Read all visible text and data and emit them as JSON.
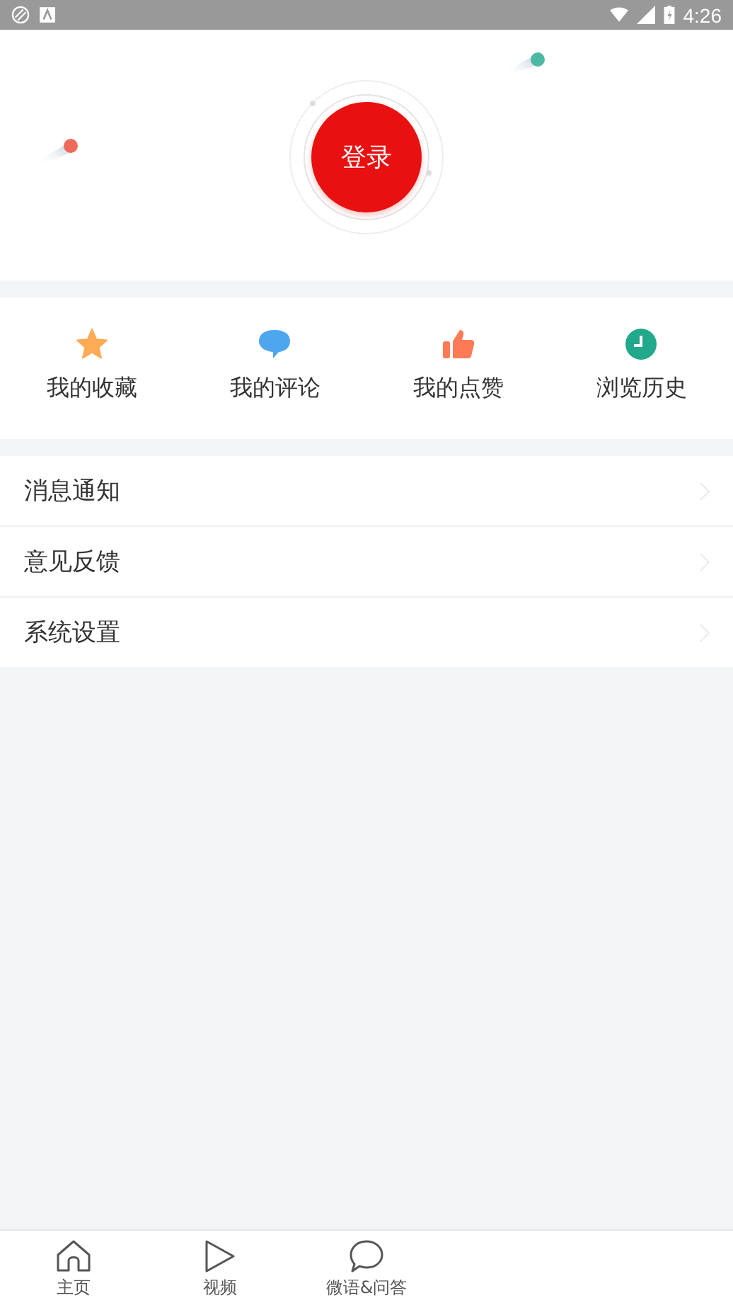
{
  "status_bar": {
    "time": "4:26"
  },
  "login": {
    "label": "登录"
  },
  "shortcuts": [
    {
      "kind": "star",
      "label": "我的收藏"
    },
    {
      "kind": "comment",
      "label": "我的评论"
    },
    {
      "kind": "like",
      "label": "我的点赞"
    },
    {
      "kind": "clock",
      "label": "浏览历史"
    }
  ],
  "menu": [
    {
      "label": "消息通知"
    },
    {
      "label": "意见反馈"
    },
    {
      "label": "系统设置"
    }
  ],
  "bottom_nav": [
    {
      "kind": "home",
      "label": "主页"
    },
    {
      "kind": "play",
      "label": "视频"
    },
    {
      "kind": "chat",
      "label": "微语&问答"
    }
  ]
}
